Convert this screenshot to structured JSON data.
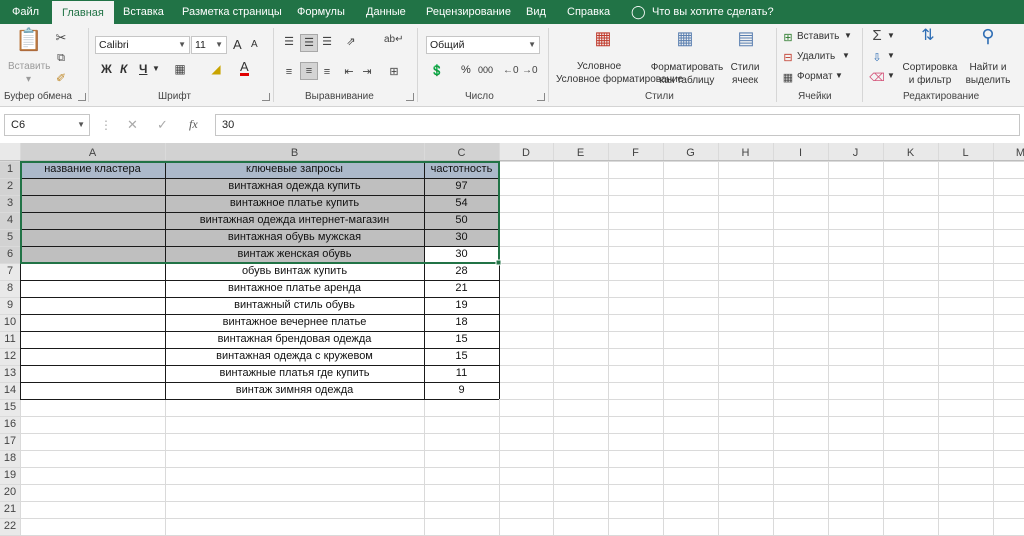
{
  "tabs": [
    "Файл",
    "Главная",
    "Вставка",
    "Разметка страницы",
    "Формулы",
    "Данные",
    "Рецензирование",
    "Вид",
    "Справка"
  ],
  "tell_me": "Что вы хотите сделать?",
  "ribbon": {
    "clipboard": {
      "paste": "Вставить",
      "label": "Буфер обмена"
    },
    "font": {
      "name": "Calibri",
      "size": "11",
      "bold": "Ж",
      "italic": "К",
      "underline": "Ч",
      "grow": "A",
      "shrink": "A",
      "color_letter": "A",
      "label": "Шрифт"
    },
    "alignment": {
      "label": "Выравнивание"
    },
    "number": {
      "format": "Общий",
      "percent": "%",
      "thousands": "000",
      "label": "Число"
    },
    "styles": {
      "conditional": "Условное форматирование",
      "format_table": "Форматировать как таблицу",
      "cell_styles": "Стили ячеек",
      "label": "Стили"
    },
    "cells": {
      "insert": "Вставить",
      "delete": "Удалить",
      "format": "Формат",
      "label": "Ячейки"
    },
    "editing": {
      "sort_filter": "Сортировка и фильтр",
      "find_select": "Найти и выделить",
      "label": "Редактирование"
    }
  },
  "formula_bar": {
    "name_box": "C6",
    "fx": "fx",
    "value": "30"
  },
  "columns": [
    "A",
    "B",
    "C",
    "D",
    "E",
    "F",
    "G",
    "H",
    "I",
    "J",
    "K",
    "L",
    "M"
  ],
  "rows": [
    "1",
    "2",
    "3",
    "4",
    "5",
    "6",
    "7",
    "8",
    "9",
    "10",
    "11",
    "12",
    "13",
    "14",
    "15",
    "16",
    "17",
    "18",
    "19",
    "20",
    "21",
    "22"
  ],
  "table": {
    "headers": [
      "название кластера",
      "ключевые запросы",
      "частотность"
    ],
    "rows": [
      {
        "a": "",
        "b": "винтажная одежда купить",
        "c": "97"
      },
      {
        "a": "",
        "b": "винтажное платье купить",
        "c": "54"
      },
      {
        "a": "",
        "b": "винтажная одежда интернет-магазин",
        "c": "50"
      },
      {
        "a": "",
        "b": "винтажная обувь мужская",
        "c": "30"
      },
      {
        "a": "",
        "b": "винтаж женская обувь",
        "c": "30"
      },
      {
        "a": "",
        "b": "обувь винтаж купить",
        "c": "28"
      },
      {
        "a": "",
        "b": "винтажное платье аренда",
        "c": "21"
      },
      {
        "a": "",
        "b": "винтажный стиль обувь",
        "c": "19"
      },
      {
        "a": "",
        "b": "винтажное вечернее платье",
        "c": "18"
      },
      {
        "a": "",
        "b": "винтажная брендовая одежда",
        "c": "15"
      },
      {
        "a": "",
        "b": "винтажная одежда с кружевом",
        "c": "15"
      },
      {
        "a": "",
        "b": "винтажные платья где купить",
        "c": "11"
      },
      {
        "a": "",
        "b": "винтаж зимняя одежда",
        "c": "9"
      }
    ]
  },
  "colors": {
    "excel_green": "#217346",
    "selection_fill": "#bfbfbf",
    "header_fill": "#acb9ca"
  }
}
